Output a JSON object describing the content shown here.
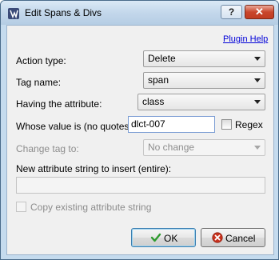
{
  "window": {
    "title": "Edit Spans & Divs",
    "help_glyph": "?",
    "close_glyph": "✕"
  },
  "plugin_help": "Plugin Help",
  "action_type": {
    "label": "Action type:",
    "value": "Delete"
  },
  "tag_name": {
    "label": "Tag name:",
    "value": "span"
  },
  "attribute": {
    "label": "Having the attribute:",
    "value": "class"
  },
  "attribute_value": {
    "label": "Whose value is (no quotes):",
    "value": "dlct-007"
  },
  "regex": {
    "label": "Regex",
    "checked": false
  },
  "change_tag": {
    "label": "Change tag to:",
    "value": "No change"
  },
  "new_attribute": {
    "label": "New attribute string to insert (entire):",
    "value": ""
  },
  "copy_existing": {
    "label": "Copy existing attribute string",
    "checked": false
  },
  "buttons": {
    "ok": "OK",
    "cancel": "Cancel"
  },
  "colors": {
    "ok_check": "#2e9b2e",
    "cancel_icon": "#c8321e",
    "link": "#0000d8"
  }
}
